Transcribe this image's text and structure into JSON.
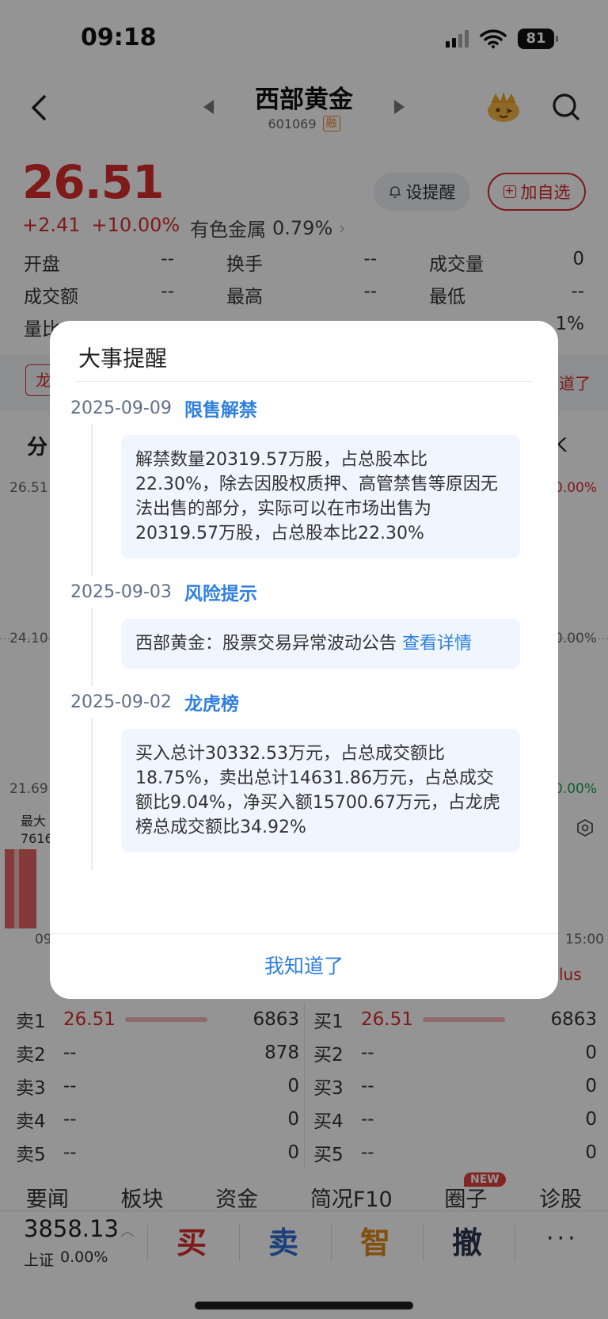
{
  "status": {
    "time": "09:18",
    "battery": "81"
  },
  "header": {
    "stock_name": "西部黄金",
    "stock_code": "601069",
    "margin_badge": "融"
  },
  "quote": {
    "price": "26.51",
    "change": "+2.41",
    "change_pct": "+10.00%",
    "sector_name": "有色金属",
    "sector_pct": "0.79%",
    "alert_label": "设提醒",
    "watch_label": "加自选"
  },
  "stats": [
    [
      {
        "label": "开盘",
        "value": "--"
      },
      {
        "label": "换手",
        "value": "--"
      },
      {
        "label": "成交量",
        "value": "0"
      }
    ],
    [
      {
        "label": "成交额",
        "value": "--"
      },
      {
        "label": "最高",
        "value": "--"
      },
      {
        "label": "最低",
        "value": "--"
      }
    ]
  ],
  "stats_partial": {
    "row3_label": "量比",
    "row3_right": "1%"
  },
  "background": {
    "strip_tag": "龙",
    "strip_right": "道了",
    "tab_left": "分",
    "tab_right": "K",
    "axis_top_left": "26.51",
    "axis_mid_left": "24.10",
    "axis_bottom_left": "21.69",
    "axis_top_right": "0.00%",
    "axis_mid_right": "0.00%",
    "axis_bottom_right": "0.00%",
    "vol_label": "最大",
    "vol_value": "7616",
    "vol_value2": "7616",
    "time_start": "09",
    "time_end": "15:00",
    "plus_tag": "lus"
  },
  "order_book": {
    "sell": [
      {
        "label": "卖1",
        "price": "26.51",
        "qty": "6863"
      },
      {
        "label": "卖2",
        "price": "--",
        "qty": "878"
      },
      {
        "label": "卖3",
        "price": "--",
        "qty": "0"
      },
      {
        "label": "卖4",
        "price": "--",
        "qty": "0"
      },
      {
        "label": "卖5",
        "price": "--",
        "qty": "0"
      }
    ],
    "buy": [
      {
        "label": "买1",
        "price": "26.51",
        "qty": "6863"
      },
      {
        "label": "买2",
        "price": "--",
        "qty": "0"
      },
      {
        "label": "买3",
        "price": "--",
        "qty": "0"
      },
      {
        "label": "买4",
        "price": "--",
        "qty": "0"
      },
      {
        "label": "买5",
        "price": "--",
        "qty": "0"
      }
    ]
  },
  "bottom_tabs": [
    "要闻",
    "板块",
    "资金",
    "简况F10",
    "圈子",
    "诊股"
  ],
  "new_badge": "NEW",
  "trade_bar": {
    "index_value": "3858.13",
    "index_name": "上证",
    "index_pct": "0.00%",
    "buy": "买",
    "sell": "卖",
    "smart": "智",
    "cancel": "撤",
    "more": "···"
  },
  "modal": {
    "title": "大事提醒",
    "events": [
      {
        "date": "2025-09-09",
        "type": "限售解禁",
        "text": "解禁数量20319.57万股，占总股本比22.30%，除去因股权质押、高管禁售等原因无法出售的部分，实际可以在市场出售为20319.57万股，占总股本比22.30%"
      },
      {
        "date": "2025-09-03",
        "type": "风险提示",
        "text": "西部黄金：股票交易异常波动公告",
        "link": "查看详情"
      },
      {
        "date": "2025-09-02",
        "type": "龙虎榜",
        "text": "买入总计30332.53万元，占总成交额比18.75%，卖出总计14631.86万元，占总成交额比9.04%，净买入额15700.67万元，占龙虎榜总成交额比34.92%"
      }
    ],
    "confirm": "我知道了"
  },
  "colors": {
    "up": "#d92d2d",
    "link": "#2f7fe0",
    "card_bg": "#f0f6ff"
  },
  "icons": [
    "back-icon",
    "search-icon",
    "mascot-icon",
    "bell-icon",
    "plus-icon",
    "gear-icon",
    "wifi-icon",
    "signal-icon"
  ]
}
